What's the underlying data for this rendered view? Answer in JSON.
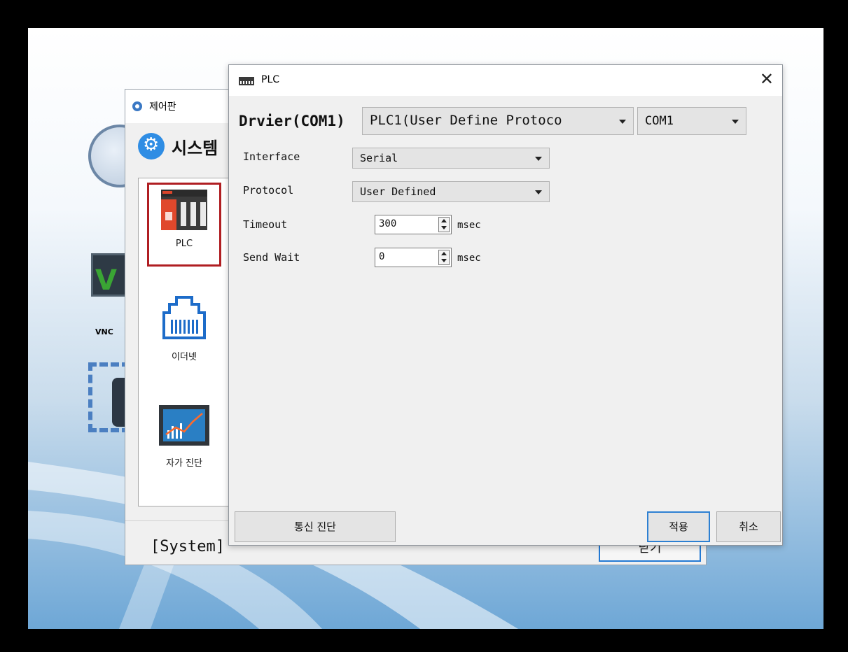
{
  "desktop": {
    "icon_labels": [
      "VNC"
    ]
  },
  "control_panel": {
    "title": "제어판",
    "header_text": "시스템",
    "side_items": [
      {
        "label": "PLC",
        "icon": "plc-device-icon",
        "selected": true
      },
      {
        "label": "이더넷",
        "icon": "ethernet-port-icon",
        "selected": false
      },
      {
        "label": "자가 진단",
        "icon": "diagnostics-chart-icon",
        "selected": false
      }
    ],
    "footer_text": "[System]",
    "footer_button": "닫기"
  },
  "plc_dialog": {
    "title": "PLC",
    "close_glyph": "✕",
    "driver_label": "Drvier(COM1)",
    "driver_value": "PLC1(User Define Protoco",
    "port_value": "COM1",
    "interface": {
      "label": "Interface",
      "value": "Serial"
    },
    "protocol": {
      "label": "Protocol",
      "value": "User Defined"
    },
    "timeout": {
      "label": "Timeout",
      "value": "300",
      "unit": "msec"
    },
    "send_wait": {
      "label": "Send Wait",
      "value": "0",
      "unit": "msec"
    },
    "buttons": {
      "diag": "통신 진단",
      "apply": "적용",
      "cancel": "취소"
    }
  },
  "colors": {
    "selected_border": "#b01e22",
    "focus_blue": "#2d80d2"
  }
}
